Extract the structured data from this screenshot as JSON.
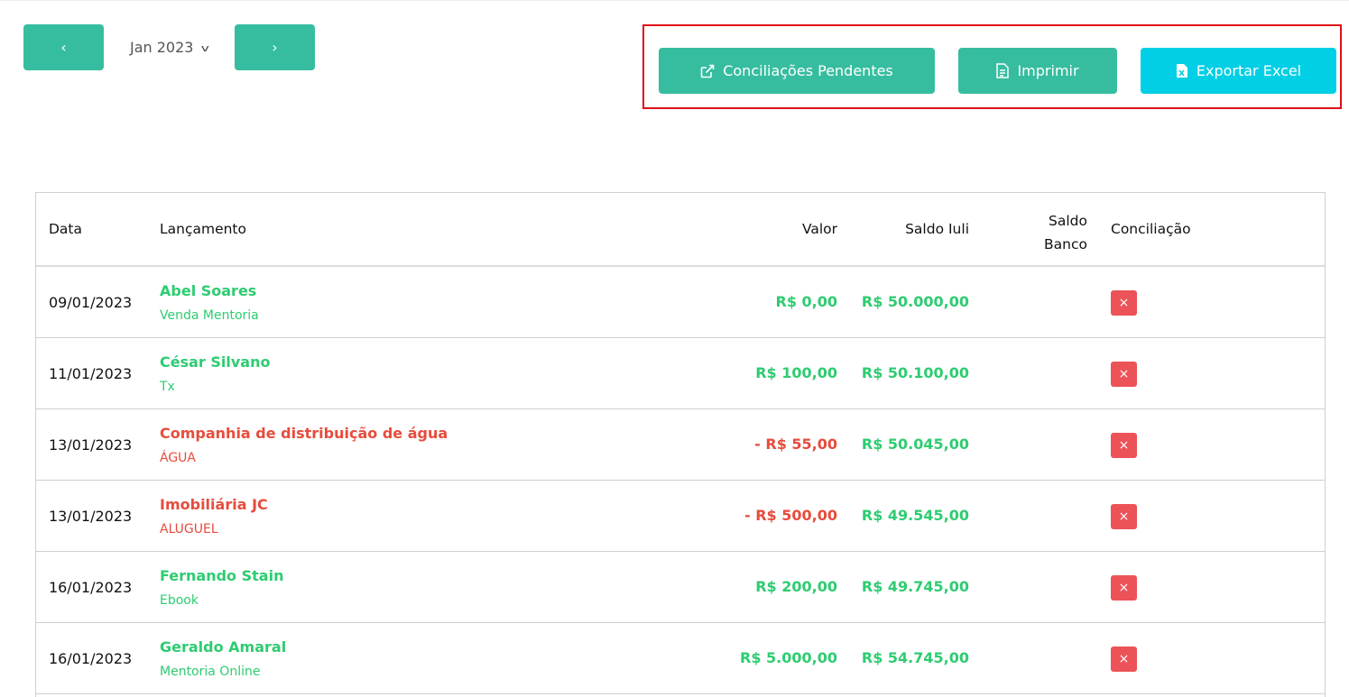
{
  "nav": {
    "prev_label": "‹",
    "next_label": "›",
    "month": "Jan 2023"
  },
  "actions": {
    "pendentes_label": "Conciliações Pendentes",
    "imprimir_label": "Imprimir",
    "excel_label": "Exportar Excel"
  },
  "table": {
    "headers": {
      "data": "Data",
      "lancamento": "Lançamento",
      "valor": "Valor",
      "saldo_iuli": "Saldo Iuli",
      "saldo_banco_1": "Saldo",
      "saldo_banco_2": "Banco",
      "conciliacao": "Conciliação"
    },
    "rows": [
      {
        "date": "09/01/2023",
        "name": "Abel Soares",
        "sub": "Venda Mentoria",
        "valor": "R$ 0,00",
        "saldo": "R$ 50.000,00",
        "conc": "×"
      },
      {
        "date": "11/01/2023",
        "name": "César Silvano",
        "sub": "Tx",
        "valor": "R$ 100,00",
        "saldo": "R$ 50.100,00",
        "conc": "×"
      },
      {
        "date": "13/01/2023",
        "name": "Companhia de distribuição de água",
        "sub": "ÁGUA",
        "valor": "- R$ 55,00",
        "saldo": "R$ 50.045,00",
        "conc": "×"
      },
      {
        "date": "13/01/2023",
        "name": "Imobiliária JC",
        "sub": "ALUGUEL",
        "valor": "- R$ 500,00",
        "saldo": "R$ 49.545,00",
        "conc": "×"
      },
      {
        "date": "16/01/2023",
        "name": "Fernando Stain",
        "sub": "Ebook",
        "valor": "R$ 200,00",
        "saldo": "R$ 49.745,00",
        "conc": "×"
      },
      {
        "date": "16/01/2023",
        "name": "Geraldo Amaral",
        "sub": "Mentoria Online",
        "valor": "R$ 5.000,00",
        "saldo": "R$ 54.745,00",
        "conc": "×"
      }
    ]
  },
  "colors": {
    "primary": "#36bd9f",
    "excel": "#00cfe5",
    "positive": "#2ecc71",
    "negative": "#e74c3c",
    "highlight_box": "#e10f16",
    "danger": "#ec5358"
  }
}
